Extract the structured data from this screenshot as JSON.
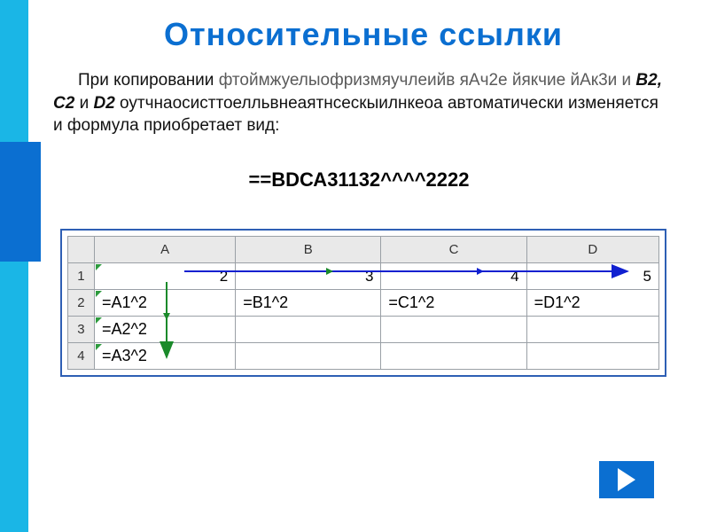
{
  "colors": {
    "accent": "#1AB6E6",
    "primary": "#0B6FD1"
  },
  "title": "Относительные ссылки",
  "paragraph": {
    "pre": "При копировании ",
    "mix": "фтоймжуелыофризмяучлеийв яАч2е йякчие йАк3и и",
    "cells": " B2, C2 ",
    "and": "и ",
    "d2": "D2",
    "middle": " оутчнаосисттоелльвнеаятнсескыилнкеоа автоматически изменяется и формула приобретает вид:"
  },
  "formula_overlap": "==ВDСА31132^^^^2222",
  "sheet": {
    "cols": [
      "A",
      "B",
      "C",
      "D"
    ],
    "rows": [
      "1",
      "2",
      "3",
      "4"
    ],
    "data": {
      "r1": {
        "A": "2",
        "B": "3",
        "C": "4",
        "D": "5"
      },
      "r2": {
        "A": "=A1^2",
        "B": "=B1^2",
        "C": "=C1^2",
        "D": "=D1^2"
      },
      "r3": {
        "A": "=A2^2",
        "B": "",
        "C": "",
        "D": ""
      },
      "r4": {
        "A": "=A3^2",
        "B": "",
        "C": "",
        "D": ""
      }
    }
  },
  "nav": {
    "next": "next"
  }
}
